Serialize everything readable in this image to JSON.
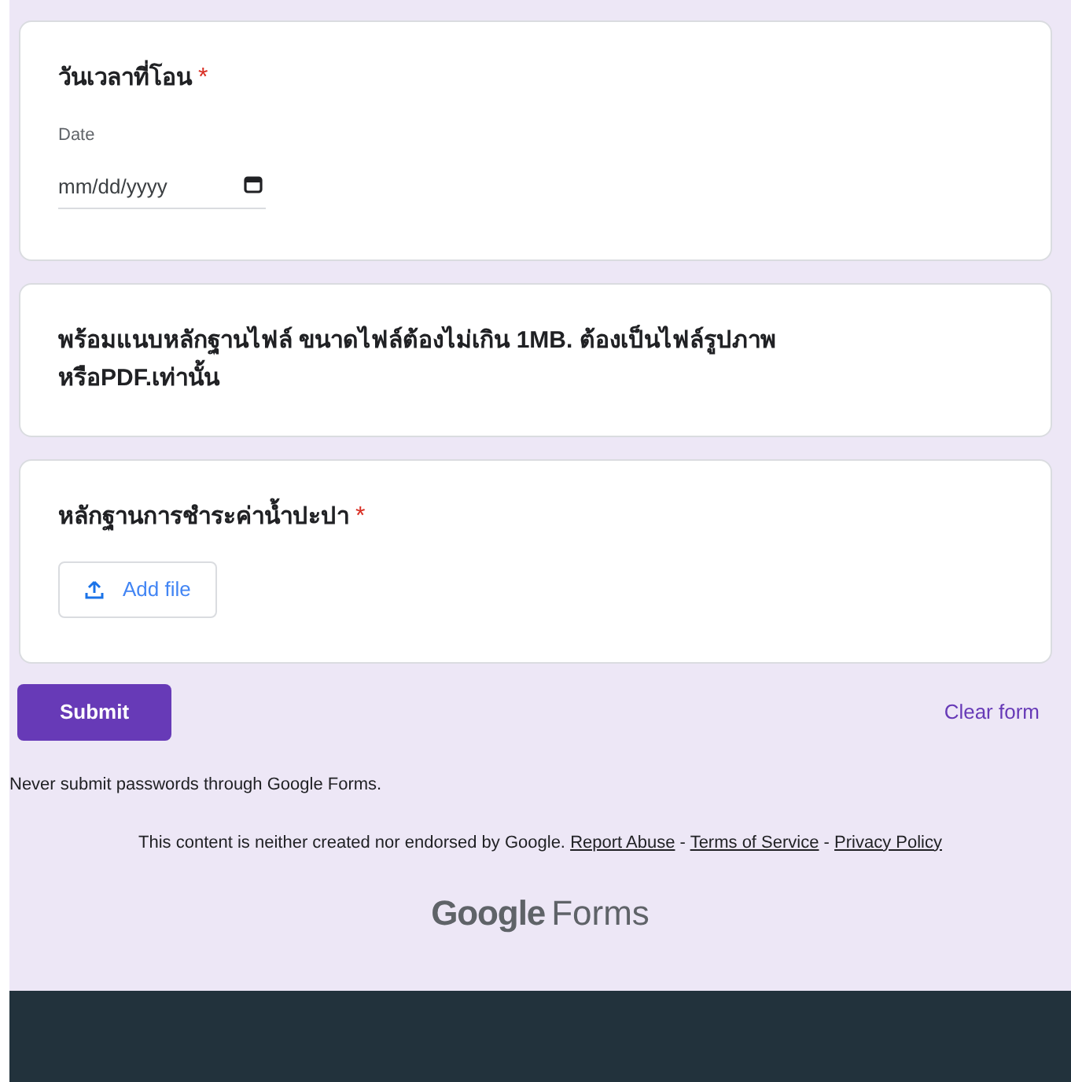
{
  "questions": [
    {
      "kind": "date",
      "title": "วันเวลาที่โอน",
      "required": true,
      "field_label": "Date",
      "placeholder": "mm/dd/yyyy"
    },
    {
      "kind": "statement",
      "title": "พร้อมแนบหลักฐานไฟล์ ขนาดไฟล์ต้องไม่เกิน 1MB. ต้องเป็นไฟล์รูปภาพ หรือPDF.เท่านั้น"
    },
    {
      "kind": "file_upload",
      "title": "หลักฐานการชำระค่าน้ำปะปา",
      "required": true,
      "button": "Add file"
    }
  ],
  "submit": "Submit",
  "clear": "Clear form",
  "password_note": "Never submit passwords through Google Forms.",
  "disclaimer": "This content is neither created nor endorsed by Google.",
  "links": [
    "Report Abuse",
    "Terms of Service",
    "Privacy Policy"
  ],
  "separator": "-",
  "required_mark": "*",
  "logo": {
    "brand": "Google",
    "product": "Forms"
  }
}
